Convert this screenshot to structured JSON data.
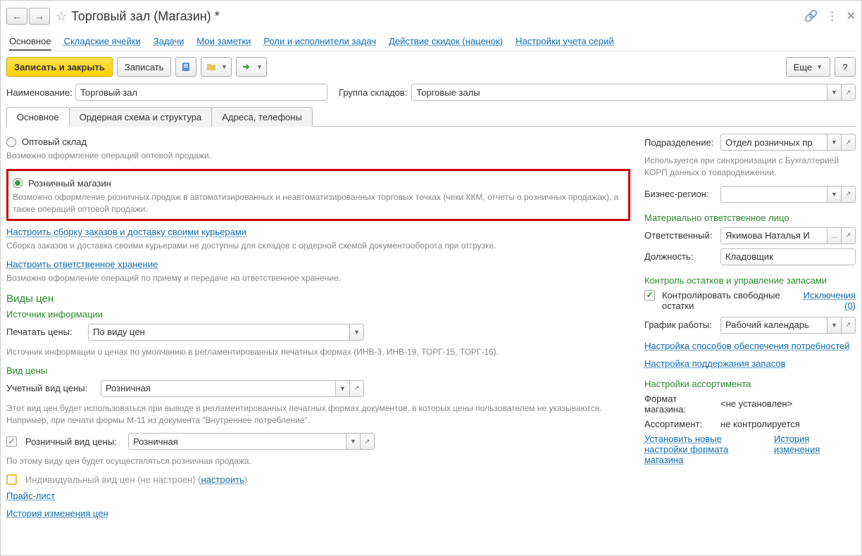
{
  "title": "Торговый зал (Магазин) *",
  "top_tabs": {
    "t0": "Основное",
    "t1": "Складские ячейки",
    "t2": "Задачи",
    "t3": "Мои заметки",
    "t4": "Роли и исполнители задач",
    "t5": "Действие скидок (наценок)",
    "t6": "Настройки учета серий"
  },
  "toolbar": {
    "save_close": "Записать и закрыть",
    "save": "Записать",
    "more": "Еще",
    "help": "?"
  },
  "fields": {
    "name_label": "Наименование:",
    "name_value": "Торговый зал",
    "group_label": "Группа складов:",
    "group_value": "Торговые залы"
  },
  "sub_tabs": {
    "s0": "Основное",
    "s1": "Ордерная схема и структура",
    "s2": "Адреса, телефоны"
  },
  "left": {
    "opt_wholesale": "Оптовый склад",
    "opt_wholesale_hint": "Возможно оформление операций оптовой продажи.",
    "opt_retail": "Розничный магазин",
    "opt_retail_hint": "Возможно оформление розничных продаж в автоматизированных и неавтоматизированных торговых точках (чеки ККМ, отчеты о розничных продажах), а также операций оптовой продажи.",
    "link_delivery": "Настроить сборку заказов и доставку своими курьерами",
    "hint_delivery": "Сборка заказов и доставка своими курьерами не доступны для складов с ордерной схемой документооборота при отгрузке.",
    "link_storage": "Настроить ответственное хранение",
    "hint_storage": "Возможно оформление операций по приему и передаче на ответственное хранение.",
    "prices_title": "Виды цен",
    "info_source": "Источник информации",
    "print_prices_label": "Печатать цены:",
    "print_prices_value": "По виду цен",
    "print_prices_hint": "Источник информации о ценах по умолчанию в регламентированных печатных формах (ИНВ-3, ИНВ-19, ТОРГ-15, ТОРГ-16).",
    "price_type": "Вид цены",
    "accounting_price_label": "Учетный вид цены:",
    "accounting_price_value": "Розничная",
    "accounting_price_hint": "Этот вид цен будет использоваться при выводе в регламентированных печатных формах документов, в которых цены пользователем не указываются. Например, при печати формы М-11 из документа \"Внутреннее потребление\".",
    "retail_price_label": "Розничный вид цены:",
    "retail_price_value": "Розничная",
    "retail_price_hint": "По этому виду цен будет осуществляться розничная продажа.",
    "individual_price": "Индивидуальный вид цен (не настроен) (",
    "individual_price_link": "настроить",
    "individual_price_close": ")",
    "price_list": "Прайс-лист",
    "price_history": "История изменения цен"
  },
  "right": {
    "division_label": "Подразделение:",
    "division_value": "Отдел розничных пр",
    "division_hint": "Используется при синхронизации с Бухгалтерией КОРП данных о товародвижении.",
    "region_label": "Бизнес-регион:",
    "region_value": "",
    "responsible_title": "Материально ответственное лицо",
    "responsible_label": "Ответственный:",
    "responsible_value": "Якимова Наталья И",
    "position_label": "Должность:",
    "position_value": "Кладовщик",
    "stock_title": "Контроль остатков и управление запасами",
    "stock_check": "Контролировать свободные остатки",
    "stock_exceptions": "Исключения (0)",
    "schedule_label": "График работы:",
    "schedule_value": "Рабочий календарь",
    "link_supply": "Настройка способов обеспечения потребностей",
    "link_stock": "Настройка поддержания запасов",
    "assort_title": "Настройки ассортимента",
    "format_label": "Формат магазина:",
    "format_value": "<не установлен>",
    "assort_label": "Ассортимент:",
    "assort_value": "не контролируется",
    "link_new_format": "Установить новые настройки формата магазина",
    "link_history": "История изменения"
  }
}
